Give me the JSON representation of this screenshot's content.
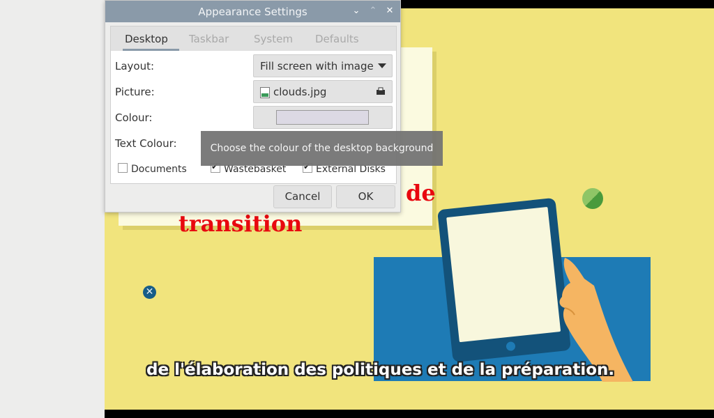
{
  "dialog": {
    "title": "Appearance Settings",
    "titlebar_buttons": {
      "minimize": "⌄",
      "maximize": "⌃",
      "close": "✕"
    },
    "tabs": [
      {
        "label": "Desktop",
        "active": true
      },
      {
        "label": "Taskbar",
        "active": false
      },
      {
        "label": "System",
        "active": false
      },
      {
        "label": "Defaults",
        "active": false
      }
    ],
    "rows": {
      "layout_label": "Layout:",
      "layout_value": "Fill screen with image",
      "picture_label": "Picture:",
      "picture_value": "clouds.jpg",
      "colour_label": "Colour:",
      "colour_value": "#dcd9e4",
      "text_colour_label": "Text Colour:"
    },
    "checkboxes": [
      {
        "label": "Documents",
        "checked": false
      },
      {
        "label": "Wastebasket",
        "checked": true
      },
      {
        "label": "External Disks",
        "checked": true
      }
    ],
    "buttons": {
      "cancel": "Cancel",
      "ok": "OK"
    }
  },
  "tooltip": {
    "text": "Choose the colour of the desktop background"
  },
  "background_video": {
    "title_words": [
      "de",
      "transition"
    ],
    "subtitle": "de l'élaboration des politiques et de la préparation.",
    "colors": {
      "bg": "#f1e47d",
      "accent_red": "#e8080f",
      "blue": "#1e7bb5"
    }
  },
  "icons": {
    "image_file": "image-file-icon",
    "open_folder": "open-folder-icon",
    "dropdown": "chevron-down-icon"
  }
}
